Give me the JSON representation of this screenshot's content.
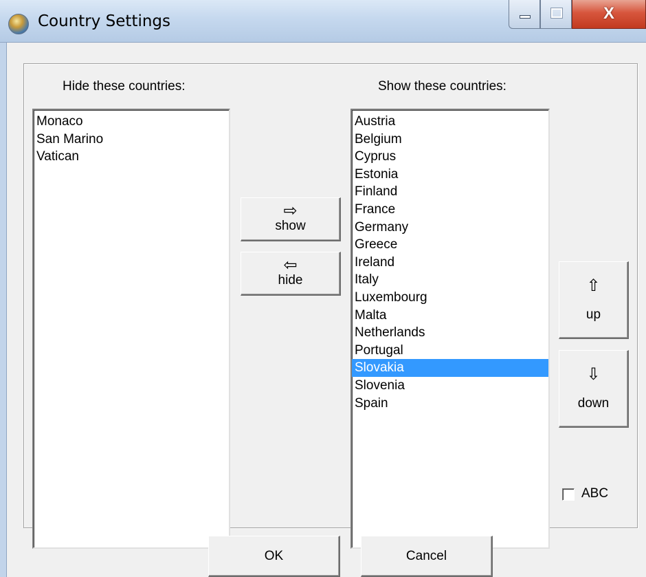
{
  "window": {
    "title": "Country Settings",
    "close_glyph": "X"
  },
  "hidden_panel": {
    "label": "Hide these countries:",
    "items": [
      "Monaco",
      "San Marino",
      "Vatican"
    ]
  },
  "shown_panel": {
    "label": "Show these countries:",
    "items": [
      "Austria",
      "Belgium",
      "Cyprus",
      "Estonia",
      "Finland",
      "France",
      "Germany",
      "Greece",
      "Ireland",
      "Italy",
      "Luxembourg",
      "Malta",
      "Netherlands",
      "Portugal",
      "Slovakia",
      "Slovenia",
      "Spain"
    ],
    "selected": "Slovakia"
  },
  "transfer": {
    "show_glyph": "⇨",
    "show_label": "show",
    "hide_glyph": "⇦",
    "hide_label": "hide"
  },
  "order": {
    "up_glyph": "⇧",
    "up_label": "up",
    "down_glyph": "⇩",
    "down_label": "down"
  },
  "sort_checkbox": {
    "label": "ABC",
    "checked": false
  },
  "dialog_buttons": {
    "ok": "OK",
    "cancel": "Cancel"
  },
  "colors": {
    "selection": "#3399ff",
    "window_bg": "#f0f0f0",
    "close_button": "#c23a1f"
  }
}
